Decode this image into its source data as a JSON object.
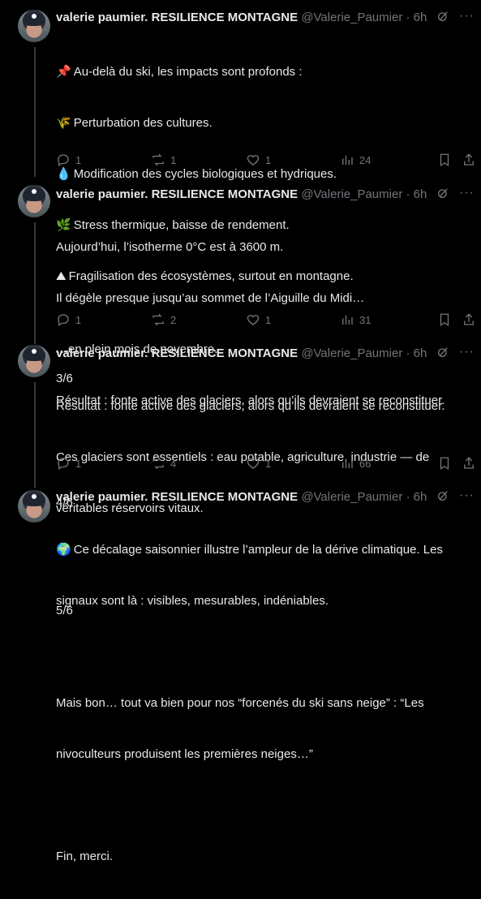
{
  "tweets": [
    {
      "author": "valerie paumier. RESILIENCE MONTAGNE",
      "handle": "@Valerie_Paumier",
      "time": "6h",
      "lines": [
        {
          "emoji": "📌",
          "text": "Au-delà du ski, les impacts sont profonds :"
        },
        {
          "emoji": "🌾",
          "text": "Perturbation des cultures."
        },
        {
          "emoji": "💧",
          "text": "Modification des cycles biologiques et hydriques."
        },
        {
          "emoji": "🌿",
          "text": "Stress thermique, baisse de rendement."
        },
        {
          "emoji": "⛰",
          "text": "Fragilisation des écosystèmes, surtout en montagne."
        },
        {
          "emoji": "",
          "text": ""
        },
        {
          "emoji": "",
          "text": "3/6"
        }
      ],
      "replies": "1",
      "reposts": "1",
      "likes": "1",
      "views": "24"
    },
    {
      "author": "valerie paumier. RESILIENCE MONTAGNE",
      "handle": "@Valerie_Paumier",
      "time": "6h",
      "lines": [
        {
          "emoji": "",
          "text": "Aujourd’hui, l’isotherme 0°C est à 3600 m."
        },
        {
          "emoji": "",
          "text": "Il dégèle presque jusqu’au sommet de l’Aiguille du Midi…"
        },
        {
          "emoji": "",
          "text": "…en plein mois de novembre."
        },
        {
          "emoji": "",
          "text": "Résultat : fonte active des glaciers, alors qu’ils devraient se reconstituer."
        },
        {
          "emoji": "",
          "text": ""
        },
        {
          "emoji": "",
          "text": "4/6"
        }
      ],
      "replies": "1",
      "reposts": "2",
      "likes": "1",
      "views": "31"
    },
    {
      "author": "valerie paumier. RESILIENCE MONTAGNE",
      "handle": "@Valerie_Paumier",
      "time": "6h",
      "lines": [
        {
          "emoji": "",
          "text": "Résultat : fonte active des glaciers, alors qu’ils devraient se reconstituer."
        },
        {
          "emoji": "",
          "text": "Ces glaciers sont essentiels : eau potable, agriculture, industrie — de"
        },
        {
          "emoji": "",
          "text": "véritables réservoirs vitaux."
        },
        {
          "emoji": "",
          "text": ""
        },
        {
          "emoji": "",
          "text": "5/6"
        }
      ],
      "replies": "1",
      "reposts": "4",
      "likes": "1",
      "views": "66"
    },
    {
      "author": "valerie paumier. RESILIENCE MONTAGNE",
      "handle": "@Valerie_Paumier",
      "time": "6h",
      "lines": [
        {
          "emoji": "🌍",
          "text": "Ce décalage saisonnier illustre l’ampleur de la dérive climatique. Les"
        },
        {
          "emoji": "",
          "text": "signaux sont là : visibles, mesurables, indéniables."
        },
        {
          "emoji": "",
          "text": ""
        },
        {
          "emoji": "",
          "text": "Mais bon… tout va bien pour nos “forcenés du ski sans neige” : “Les"
        },
        {
          "emoji": "",
          "text": "nivoculteurs produisent les premières neiges…”"
        },
        {
          "emoji": "",
          "text": ""
        },
        {
          "emoji": "",
          "text": "Fin, merci."
        }
      ]
    }
  ],
  "colors": {
    "background": "#000000",
    "text": "#e7e9ea",
    "muted": "#71767b",
    "divider": "#2f3336"
  }
}
